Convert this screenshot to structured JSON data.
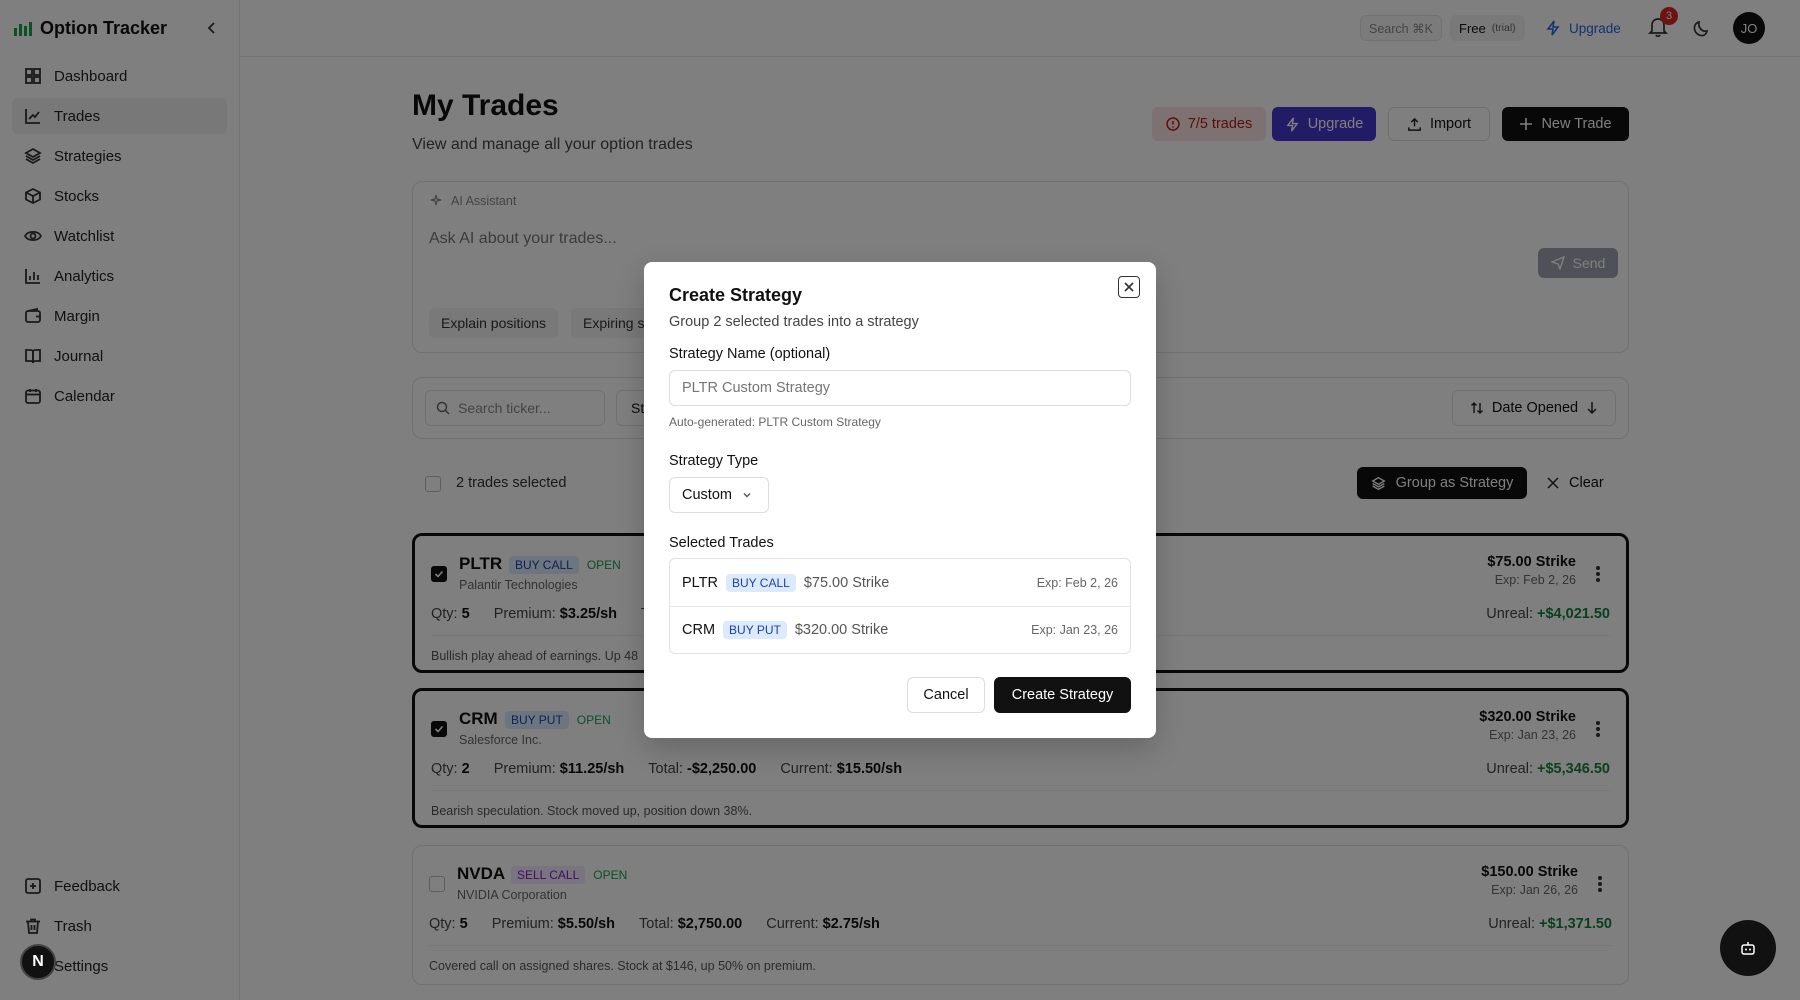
{
  "app": {
    "name": "Option Tracker",
    "accent": "#16a34a"
  },
  "sidebar": {
    "items": [
      {
        "label": "Dashboard",
        "icon": "grid-icon"
      },
      {
        "label": "Trades",
        "icon": "chart-line-icon",
        "active": true
      },
      {
        "label": "Strategies",
        "icon": "layers-icon"
      },
      {
        "label": "Stocks",
        "icon": "cube-icon"
      },
      {
        "label": "Watchlist",
        "icon": "eye-icon"
      },
      {
        "label": "Analytics",
        "icon": "bar-chart-icon"
      },
      {
        "label": "Margin",
        "icon": "wallet-icon"
      },
      {
        "label": "Journal",
        "icon": "book-icon"
      },
      {
        "label": "Calendar",
        "icon": "calendar-icon"
      }
    ],
    "bottom": [
      {
        "label": "Feedback",
        "icon": "feedback-icon"
      },
      {
        "label": "Trash",
        "icon": "trash-icon"
      },
      {
        "label": "Settings",
        "icon": "gear-icon"
      }
    ],
    "badge_letter": "N"
  },
  "topbar": {
    "search_label": "Search ⌘K",
    "plan": "Free",
    "plan_note": "(trial)",
    "upgrade": "Upgrade",
    "notifications": "3",
    "avatar_initials": "JO"
  },
  "page": {
    "title": "My Trades",
    "subtitle": "View and manage all your option trades",
    "trade_limit": "7/5 trades",
    "upgrade": "Upgrade",
    "import": "Import",
    "new_trade": "New Trade"
  },
  "ai": {
    "label": "AI Assistant",
    "placeholder": "Ask AI about your trades...",
    "send": "Send",
    "chips": [
      "Explain positions",
      "Expiring s"
    ]
  },
  "filters": {
    "search_placeholder": "Search ticker...",
    "status_partial": "St",
    "sort": "Date Opened"
  },
  "selection": {
    "count_text": "2 trades selected",
    "group": "Group as Strategy",
    "clear": "Clear"
  },
  "trades": [
    {
      "ticker": "PLTR",
      "type": "BUY CALL",
      "status": "OPEN",
      "company": "Palantir Technologies",
      "qty_label": "Qty:",
      "qty": "5",
      "premium_label": "Premium:",
      "premium": "$3.25/sh",
      "total_label": "To",
      "total": "",
      "current_label": "",
      "current": "",
      "strike": "$75.00 Strike",
      "exp": "Exp: Feb 2, 26",
      "unreal_label": "Unreal:",
      "unreal": "+$4,021.50",
      "note": "Bullish play ahead of earnings. Up 48",
      "selected": true
    },
    {
      "ticker": "CRM",
      "type": "BUY PUT",
      "status": "OPEN",
      "company": "Salesforce Inc.",
      "qty_label": "Qty:",
      "qty": "2",
      "premium_label": "Premium:",
      "premium": "$11.25/sh",
      "total_label": "Total:",
      "total": "-$2,250.00",
      "current_label": "Current:",
      "current": "$15.50/sh",
      "strike": "$320.00 Strike",
      "exp": "Exp: Jan 23, 26",
      "unreal_label": "Unreal:",
      "unreal": "+$5,346.50",
      "note": "Bearish speculation. Stock moved up, position down 38%.",
      "selected": true
    },
    {
      "ticker": "NVDA",
      "type": "SELL CALL",
      "status": "OPEN",
      "company": "NVIDIA Corporation",
      "qty_label": "Qty:",
      "qty": "5",
      "premium_label": "Premium:",
      "premium": "$5.50/sh",
      "total_label": "Total:",
      "total": "$2,750.00",
      "current_label": "Current:",
      "current": "$2.75/sh",
      "strike": "$150.00 Strike",
      "exp": "Exp: Jan 26, 26",
      "unreal_label": "Unreal:",
      "unreal": "+$1,371.50",
      "note": "Covered call on assigned shares. Stock at $146, up 50% on premium.",
      "selected": false
    }
  ],
  "modal": {
    "title": "Create Strategy",
    "description": "Group 2 selected trades into a strategy",
    "name_label": "Strategy Name (optional)",
    "name_placeholder": "PLTR Custom Strategy",
    "name_help": "Auto-generated: PLTR Custom Strategy",
    "type_label": "Strategy Type",
    "type_value": "Custom",
    "selected_label": "Selected Trades",
    "selected": [
      {
        "ticker": "PLTR",
        "type": "BUY CALL",
        "strike": "$75.00 Strike",
        "exp": "Exp: Feb 2, 26"
      },
      {
        "ticker": "CRM",
        "type": "BUY PUT",
        "strike": "$320.00 Strike",
        "exp": "Exp: Jan 23, 26"
      }
    ],
    "cancel": "Cancel",
    "create": "Create Strategy"
  }
}
